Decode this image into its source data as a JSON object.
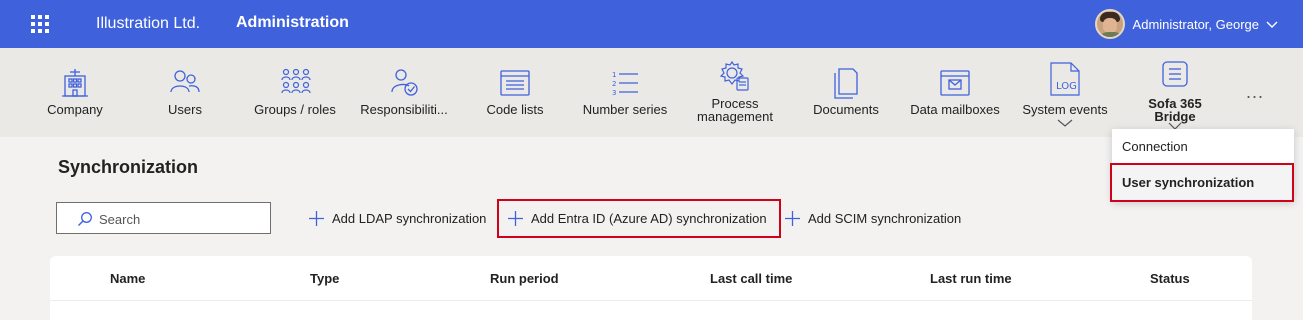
{
  "header": {
    "company": "Illustration Ltd.",
    "app": "Administration",
    "user": "Administrator, George"
  },
  "ribbon": {
    "items": [
      {
        "label": "Company",
        "icon": "building-icon"
      },
      {
        "label": "Users",
        "icon": "users-icon"
      },
      {
        "label": "Groups / roles",
        "icon": "groups-icon"
      },
      {
        "label": "Responsibiliti...",
        "icon": "responsibilities-icon"
      },
      {
        "label": "Code lists",
        "icon": "code-list-icon"
      },
      {
        "label": "Number series",
        "icon": "number-series-icon"
      },
      {
        "label": "Process management",
        "icon": "process-gear-icon"
      },
      {
        "label": "Documents",
        "icon": "documents-icon"
      },
      {
        "label": "Data mailboxes",
        "icon": "mailbox-icon"
      },
      {
        "label": "System events",
        "icon": "log-icon"
      },
      {
        "label": "Sofa 365 Bridge",
        "icon": "bridge-icon"
      }
    ],
    "more": "..."
  },
  "page": {
    "title": "Synchronization",
    "search_placeholder": "Search",
    "actions": {
      "ldap": "Add LDAP synchronization",
      "entra": "Add Entra ID (Azure AD) synchronization",
      "scim": "Add SCIM synchronization"
    }
  },
  "table": {
    "columns": [
      "Name",
      "Type",
      "Run period",
      "Last call time",
      "Last run time",
      "Status"
    ]
  },
  "dropdown": {
    "items": [
      "Connection",
      "User synchronization"
    ],
    "selected": "User synchronization"
  },
  "colors": {
    "header": "#3f62dc",
    "accent": "#3f62dc",
    "highlight": "#d0021b"
  }
}
